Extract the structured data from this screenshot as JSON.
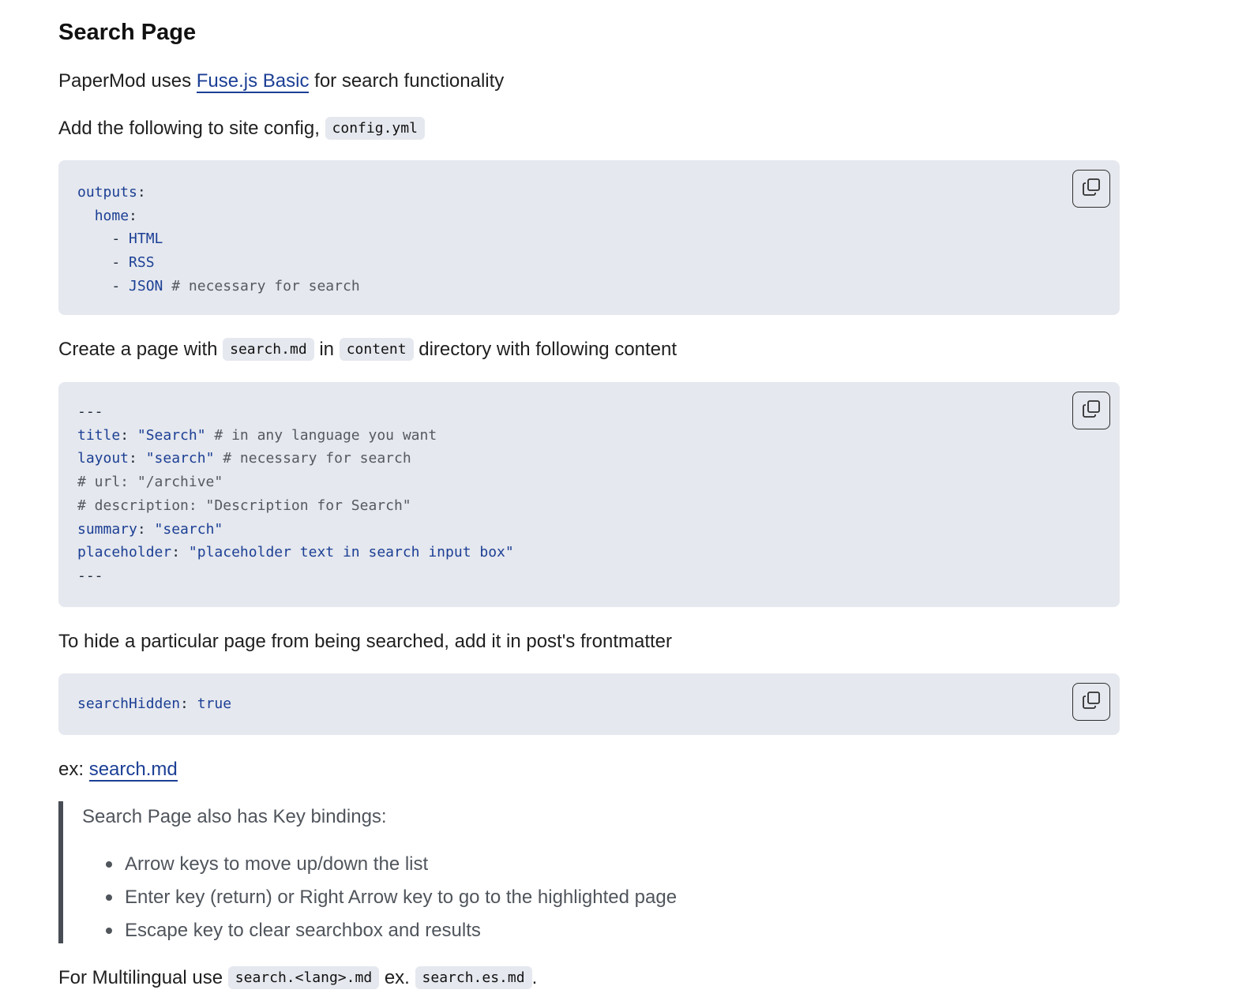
{
  "heading": "Search Page",
  "intro": {
    "prefix": "PaperMod uses ",
    "link": "Fuse.js Basic",
    "suffix": " for search functionality"
  },
  "config_para": {
    "text": "Add the following to site config, ",
    "code": "config.yml"
  },
  "codeblock_config": {
    "lines": [
      {
        "key": "outputs",
        "sep": ":"
      },
      {
        "indent": "  ",
        "key": "home",
        "sep": ":"
      },
      {
        "indent": "    ",
        "dash": "- ",
        "value": "HTML"
      },
      {
        "indent": "    ",
        "dash": "- ",
        "value": "RSS"
      },
      {
        "indent": "    ",
        "dash": "- ",
        "value": "JSON",
        "comment": " # necessary for search"
      }
    ]
  },
  "create_para": {
    "t1": "Create a page with ",
    "code1": "search.md",
    "t2": " in ",
    "code2": "content",
    "t3": " directory with following content"
  },
  "codeblock_search": {
    "lines": [
      {
        "plain": "---"
      },
      {
        "key": "title",
        "sep": ": ",
        "value": "\"Search\"",
        "comment": " # in any language you want"
      },
      {
        "key": "layout",
        "sep": ": ",
        "value": "\"search\"",
        "comment": " # necessary for search"
      },
      {
        "comment": "# url: \"/archive\""
      },
      {
        "comment": "# description: \"Description for Search\""
      },
      {
        "key": "summary",
        "sep": ": ",
        "value": "\"search\""
      },
      {
        "key": "placeholder",
        "sep": ": ",
        "value": "\"placeholder text in search input box\""
      },
      {
        "plain": "---"
      }
    ]
  },
  "hide_para": "To hide a particular page from being searched, add it in post's frontmatter",
  "codeblock_hidden": {
    "lines": [
      {
        "key": "searchHidden",
        "sep": ": ",
        "value": "true"
      }
    ]
  },
  "example": {
    "prefix": "ex: ",
    "link": "search.md"
  },
  "quote": {
    "lead": "Search Page also has Key bindings:",
    "items": [
      "Arrow keys to move up/down the list",
      "Enter key (return) or Right Arrow key to go to the highlighted page",
      "Escape key to clear searchbox and results"
    ]
  },
  "multilingual": {
    "t1": "For Multilingual use ",
    "code1": "search.<lang>.md",
    "t2": " ex. ",
    "code2": "search.es.md",
    "t3": "."
  },
  "icons": {
    "copy": "copy-icon"
  },
  "colors": {
    "link": "#1c3f95",
    "code_bg": "#e5e8ee",
    "quote_bar": "#484d55"
  }
}
